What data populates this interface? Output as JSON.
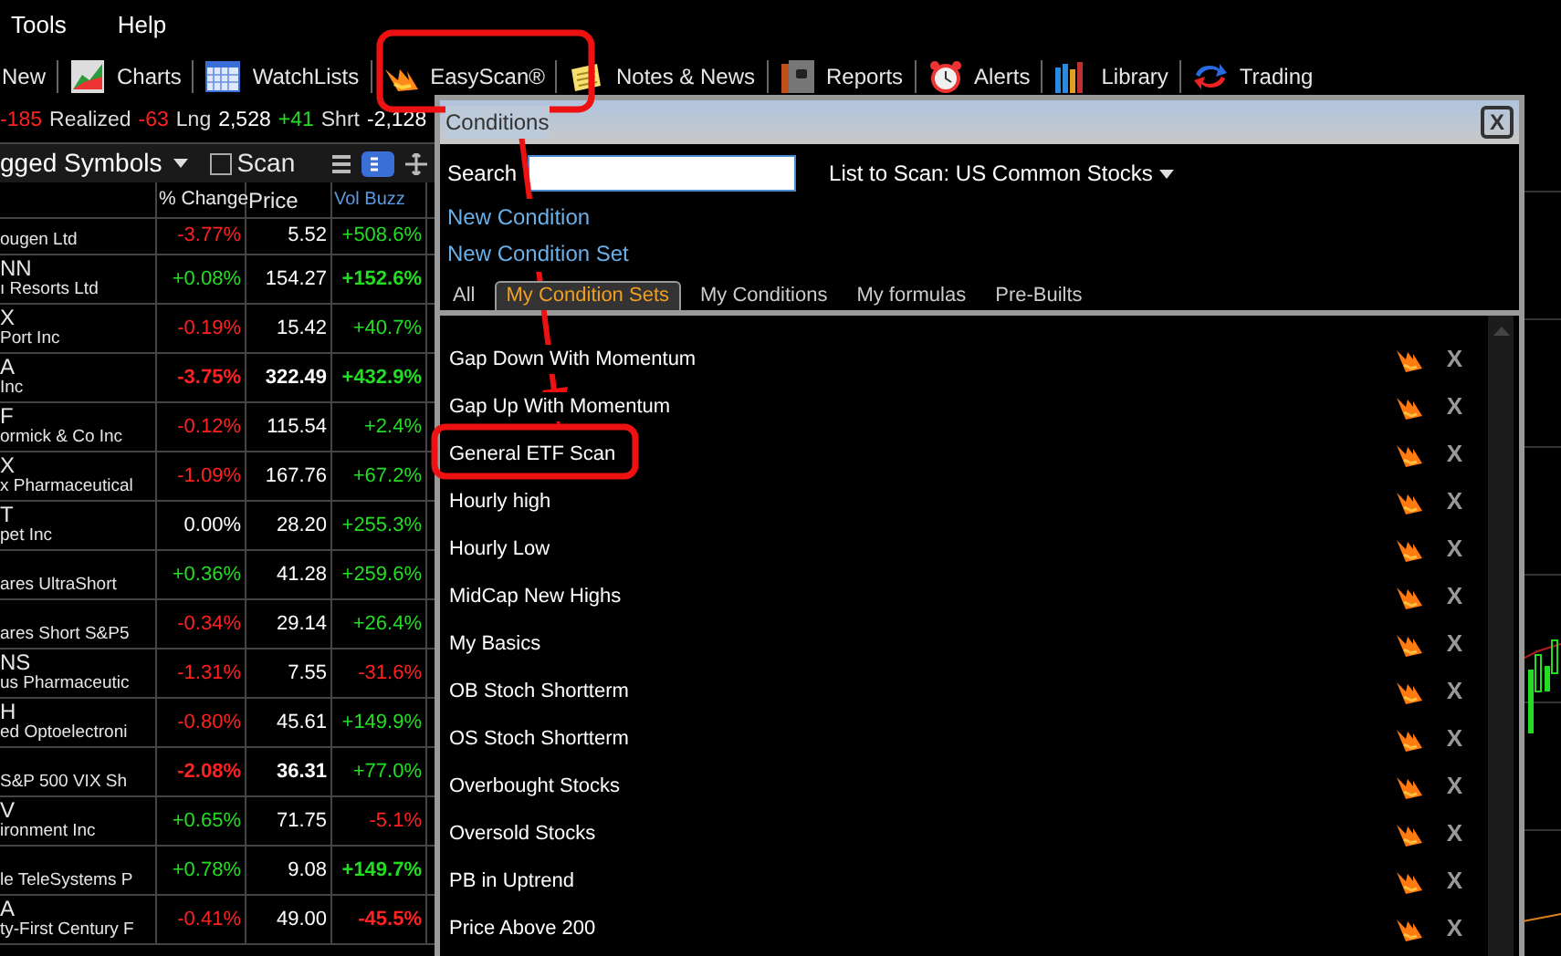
{
  "menu": [
    "Tools",
    "Help"
  ],
  "toolbar": [
    "New",
    "Charts",
    "WatchLists",
    "EasyScan®",
    "Notes & News",
    "Reports",
    "Alerts",
    "Library",
    "Trading"
  ],
  "stats": [
    {
      "text": "-185",
      "color": "#ff2020"
    },
    {
      "text": "Realized",
      "color": "#dddddd"
    },
    {
      "text": "-63",
      "color": "#ff2020"
    },
    {
      "text": "Lng",
      "color": "#dddddd"
    },
    {
      "text": "2,528",
      "color": "#ffffff"
    },
    {
      "text": "+41",
      "color": "#22dd22"
    },
    {
      "text": "Shrt",
      "color": "#dddddd"
    },
    {
      "text": "-2,128",
      "color": "#ffffff"
    }
  ],
  "watchlist": {
    "title": "gged Symbols",
    "scan_label": "Scan",
    "scan_checked": false,
    "columns": [
      "% Change",
      "Price",
      "Vol Buzz"
    ],
    "rows": [
      {
        "symbol": "",
        "name": "ougen Ltd",
        "change": {
          "text": "-3.77%",
          "color": "#ff2020",
          "bold": false
        },
        "price": {
          "text": "5.52",
          "bold": false
        },
        "buzz": {
          "text": "+508.6%",
          "color": "#22dd22",
          "bold": false
        }
      },
      {
        "symbol": "NN",
        "name": "ı Resorts Ltd",
        "change": {
          "text": "+0.08%",
          "color": "#22dd22",
          "bold": false
        },
        "price": {
          "text": "154.27",
          "bold": false
        },
        "buzz": {
          "text": "+152.6%",
          "color": "#22dd22",
          "bold": true
        }
      },
      {
        "symbol": "X",
        "name": "Port Inc",
        "change": {
          "text": "-0.19%",
          "color": "#ff2020",
          "bold": false
        },
        "price": {
          "text": "15.42",
          "bold": false
        },
        "buzz": {
          "text": "+40.7%",
          "color": "#22dd22",
          "bold": false
        }
      },
      {
        "symbol": "A",
        "name": "Inc",
        "change": {
          "text": "-3.75%",
          "color": "#ff2020",
          "bold": true
        },
        "price": {
          "text": "322.49",
          "bold": true
        },
        "buzz": {
          "text": "+432.9%",
          "color": "#22dd22",
          "bold": true
        }
      },
      {
        "symbol": "F",
        "name": "ormick & Co Inc",
        "change": {
          "text": "-0.12%",
          "color": "#ff2020",
          "bold": false
        },
        "price": {
          "text": "115.54",
          "bold": false
        },
        "buzz": {
          "text": "+2.4%",
          "color": "#22dd22",
          "bold": false
        }
      },
      {
        "symbol": "X",
        "name": "x Pharmaceutical",
        "change": {
          "text": "-1.09%",
          "color": "#ff2020",
          "bold": false
        },
        "price": {
          "text": "167.76",
          "bold": false
        },
        "buzz": {
          "text": "+67.2%",
          "color": "#22dd22",
          "bold": false
        }
      },
      {
        "symbol": "T",
        "name": "pet Inc",
        "change": {
          "text": "0.00%",
          "color": "#ffffff",
          "bold": false
        },
        "price": {
          "text": "28.20",
          "bold": false
        },
        "buzz": {
          "text": "+255.3%",
          "color": "#22dd22",
          "bold": false
        }
      },
      {
        "symbol": "",
        "name": "ares UltraShort",
        "change": {
          "text": "+0.36%",
          "color": "#22dd22",
          "bold": false
        },
        "price": {
          "text": "41.28",
          "bold": false
        },
        "buzz": {
          "text": "+259.6%",
          "color": "#22dd22",
          "bold": false
        }
      },
      {
        "symbol": "",
        "name": "ares Short S&P5",
        "change": {
          "text": "-0.34%",
          "color": "#ff2020",
          "bold": false
        },
        "price": {
          "text": "29.14",
          "bold": false
        },
        "buzz": {
          "text": "+26.4%",
          "color": "#22dd22",
          "bold": false
        }
      },
      {
        "symbol": "NS",
        "name": "us Pharmaceutic",
        "change": {
          "text": "-1.31%",
          "color": "#ff2020",
          "bold": false
        },
        "price": {
          "text": "7.55",
          "bold": false
        },
        "buzz": {
          "text": "-31.6%",
          "color": "#ff2020",
          "bold": false
        }
      },
      {
        "symbol": "H",
        "name": "ed Optoelectroni",
        "change": {
          "text": "-0.80%",
          "color": "#ff2020",
          "bold": false
        },
        "price": {
          "text": "45.61",
          "bold": false
        },
        "buzz": {
          "text": "+149.9%",
          "color": "#22dd22",
          "bold": false
        }
      },
      {
        "symbol": "",
        "name": "S&P 500 VIX Sh",
        "change": {
          "text": "-2.08%",
          "color": "#ff2020",
          "bold": true
        },
        "price": {
          "text": "36.31",
          "bold": true
        },
        "buzz": {
          "text": "+77.0%",
          "color": "#22dd22",
          "bold": false
        }
      },
      {
        "symbol": "V",
        "name": "ironment Inc",
        "change": {
          "text": "+0.65%",
          "color": "#22dd22",
          "bold": false
        },
        "price": {
          "text": "71.75",
          "bold": false
        },
        "buzz": {
          "text": "-5.1%",
          "color": "#ff2020",
          "bold": false
        }
      },
      {
        "symbol": "",
        "name": "le TeleSystems P",
        "change": {
          "text": "+0.78%",
          "color": "#22dd22",
          "bold": false
        },
        "price": {
          "text": "9.08",
          "bold": false
        },
        "buzz": {
          "text": "+149.7%",
          "color": "#22dd22",
          "bold": true
        }
      },
      {
        "symbol": "A",
        "name": "ty-First Century F",
        "change": {
          "text": "-0.41%",
          "color": "#ff2020",
          "bold": false
        },
        "price": {
          "text": "49.00",
          "bold": false
        },
        "buzz": {
          "text": "-45.5%",
          "color": "#ff2020",
          "bold": true
        }
      }
    ]
  },
  "dialog": {
    "title": "Conditions",
    "close": "X",
    "search_label": "Search",
    "list_to_scan": "List to Scan: US Common Stocks",
    "links": [
      "New Condition",
      "New Condition Set"
    ],
    "tabs": [
      {
        "label": "All",
        "selected": false
      },
      {
        "label": "My Condition Sets",
        "selected": true
      },
      {
        "label": "My Conditions",
        "selected": false
      },
      {
        "label": "My formulas",
        "selected": false
      },
      {
        "label": "Pre-Builts",
        "selected": false
      }
    ],
    "items": [
      {
        "label": "Gap Down With Momentum",
        "remove": "X"
      },
      {
        "label": "Gap Up With Momentum",
        "remove": "X"
      },
      {
        "label": "General ETF Scan",
        "remove": "X"
      },
      {
        "label": "Hourly high",
        "remove": "X"
      },
      {
        "label": "Hourly Low",
        "remove": "X"
      },
      {
        "label": "MidCap New Highs",
        "remove": "X"
      },
      {
        "label": "My Basics",
        "remove": "X"
      },
      {
        "label": "OB Stoch Shortterm",
        "remove": "X"
      },
      {
        "label": "OS Stoch Shortterm",
        "remove": "X"
      },
      {
        "label": "Overbought Stocks",
        "remove": "X"
      },
      {
        "label": "Oversold Stocks",
        "remove": "X"
      },
      {
        "label": "PB in Uptrend",
        "remove": "X"
      },
      {
        "label": "Price Above 200",
        "remove": "X"
      }
    ]
  }
}
